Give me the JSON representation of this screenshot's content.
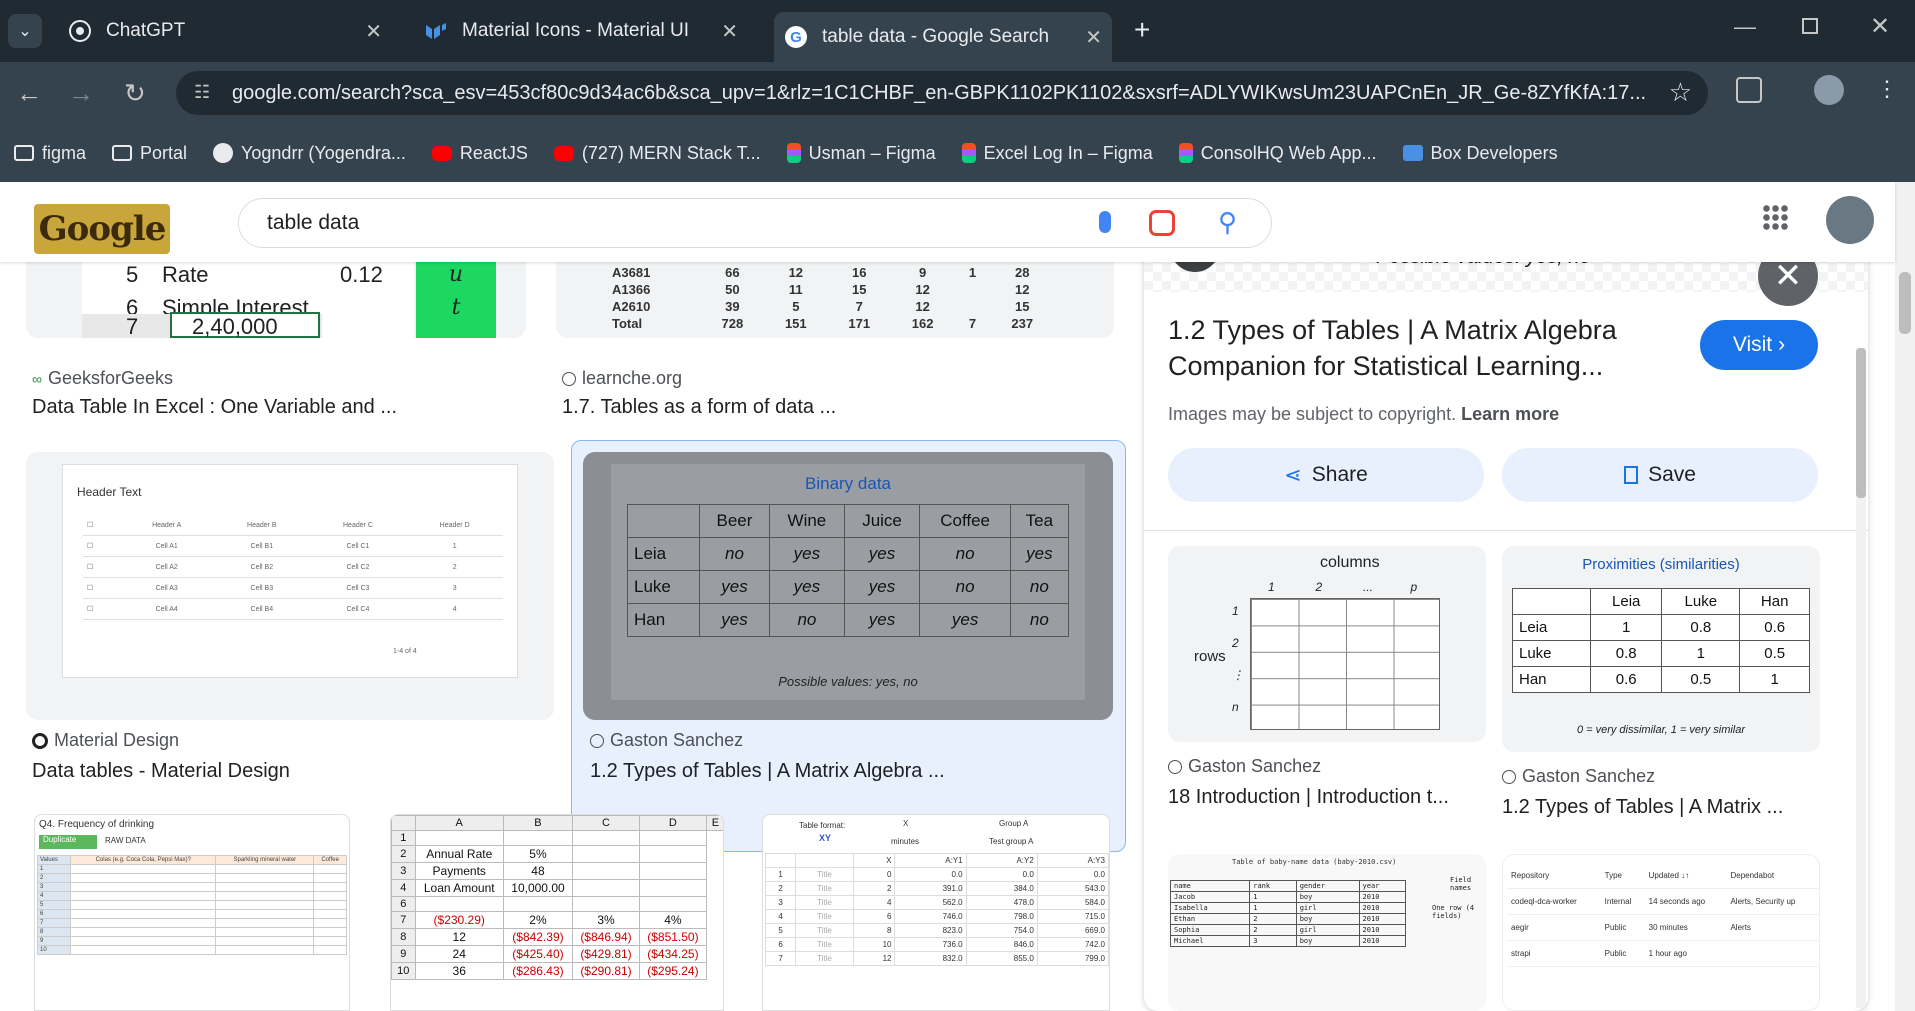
{
  "tabs": [
    {
      "title": "ChatGPT",
      "icon": "chatgpt-icon"
    },
    {
      "title": "Material Icons - Material UI",
      "icon": "mui-icon"
    },
    {
      "title": "table data - Google Search",
      "icon": "google-icon"
    }
  ],
  "omnibox": {
    "url": "google.com/search?sca_esv=453cf80c9d34ac6b&sca_upv=1&rlz=1C1CHBF_en-GBPK1102PK1102&sxsrf=ADLYWIKwsUm23UAPCnEn_JR_Ge-8ZYfKfA:17..."
  },
  "bookmarks": [
    {
      "label": "figma",
      "icon": "folder-icon"
    },
    {
      "label": "Portal",
      "icon": "folder-icon"
    },
    {
      "label": "Yogndrr (Yogendra...",
      "icon": "github-icon"
    },
    {
      "label": "ReactJS",
      "icon": "youtube-icon"
    },
    {
      "label": "(727) MERN Stack T...",
      "icon": "youtube-icon"
    },
    {
      "label": "Usman – Figma",
      "icon": "figma-icon"
    },
    {
      "label": "Excel Log In – Figma",
      "icon": "figma-icon"
    },
    {
      "label": "ConsolHQ Web App...",
      "icon": "figma-icon"
    },
    {
      "label": "Box Developers",
      "icon": "box-icon"
    }
  ],
  "search": {
    "query": "table data",
    "logo": "Google"
  },
  "results": {
    "r1": {
      "source": "GeeksforGeeks",
      "title": "Data Table In Excel : One Variable and ...",
      "rows": [
        [
          "5",
          "Rate",
          "0.12",
          "u"
        ],
        [
          "6",
          "Simple Interest",
          "",
          "t"
        ],
        [
          "7",
          "2,40,000",
          "",
          ""
        ]
      ]
    },
    "r2": {
      "source": "learnche.org",
      "title": "1.7. Tables as a form of data ...",
      "rows": [
        [
          "A3681",
          "66",
          "12",
          "16",
          "9",
          "1",
          "28"
        ],
        [
          "A1366",
          "50",
          "11",
          "15",
          "12",
          "",
          "12"
        ],
        [
          "A2610",
          "39",
          "5",
          "7",
          "12",
          "",
          "15"
        ],
        [
          "Total",
          "728",
          "151",
          "171",
          "162",
          "7",
          "237"
        ]
      ]
    },
    "r3": {
      "source": "Material Design",
      "title": "Data tables - Material Design",
      "header": "Header Text",
      "cols": [
        "Header A",
        "Header B",
        "Header C",
        "Header D"
      ],
      "rows": [
        [
          "Cell A1",
          "Cell B1",
          "Cell C1",
          "1"
        ],
        [
          "Cell A2",
          "Cell B2",
          "Cell C2",
          "2"
        ],
        [
          "Cell A3",
          "Cell B3",
          "Cell C3",
          "3"
        ],
        [
          "Cell A4",
          "Cell B4",
          "Cell C4",
          "4"
        ]
      ],
      "pager": "1-4 of 4"
    },
    "r4": {
      "source": "Gaston Sanchez",
      "title": "1.2 Types of Tables | A Matrix Algebra ...",
      "caption": "Binary data",
      "cols": [
        "",
        "Beer",
        "Wine",
        "Juice",
        "Coffee",
        "Tea"
      ],
      "rows": [
        [
          "Leia",
          "no",
          "yes",
          "yes",
          "no",
          "yes"
        ],
        [
          "Luke",
          "yes",
          "yes",
          "yes",
          "no",
          "no"
        ],
        [
          "Han",
          "yes",
          "no",
          "yes",
          "yes",
          "no"
        ]
      ],
      "footer": "Possible values:  yes,  no"
    },
    "r5": {
      "title": "Q4. Frequency of drinking",
      "btn": "Duplicate",
      "raw": "RAW DATA",
      "cols": [
        "Values",
        "Colas (e.g. Coca Cola, Pepsi Max)?",
        "Sparkling mineral water",
        "Coffee"
      ]
    },
    "r6": {
      "cols": [
        "A",
        "B",
        "C",
        "D",
        "E"
      ],
      "rows": [
        [
          "1",
          "",
          "",
          "",
          ""
        ],
        [
          "2",
          "Annual Rate",
          "5%",
          "",
          ""
        ],
        [
          "3",
          "Payments",
          "48",
          "",
          ""
        ],
        [
          "4",
          "Loan Amount",
          "10,000.00",
          "",
          ""
        ],
        [
          "6",
          "",
          "",
          "",
          ""
        ],
        [
          "7",
          "($230.29)",
          "2%",
          "3%",
          "4%"
        ],
        [
          "8",
          "12",
          "($842.39)",
          "($846.94)",
          "($851.50)"
        ],
        [
          "9",
          "24",
          "($425.40)",
          "($429.81)",
          "($434.25)"
        ],
        [
          "10",
          "36",
          "($286.43)",
          "($290.81)",
          "($295.24)"
        ]
      ]
    },
    "r7": {
      "format_label": "Table format:",
      "format_value": "XY",
      "groupA": "Group A",
      "x": "X",
      "minutes": "minutes",
      "test": "Test group A",
      "cols": [
        "X",
        "A:Y1",
        "A:Y2",
        "A:Y3"
      ],
      "rows": [
        [
          "1",
          "Title",
          "0",
          "0.0",
          "0.0",
          "0.0"
        ],
        [
          "2",
          "Title",
          "2",
          "391.0",
          "384.0",
          "543.0"
        ],
        [
          "3",
          "Title",
          "4",
          "562.0",
          "478.0",
          "584.0"
        ],
        [
          "4",
          "Title",
          "6",
          "746.0",
          "798.0",
          "715.0"
        ],
        [
          "5",
          "Title",
          "8",
          "823.0",
          "754.0",
          "669.0"
        ],
        [
          "6",
          "Title",
          "10",
          "736.0",
          "846.0",
          "742.0"
        ],
        [
          "7",
          "Title",
          "12",
          "832.0",
          "855.0",
          "799.0"
        ]
      ]
    }
  },
  "panel": {
    "top_text": "Possible values:  yes,  no",
    "title": "1.2 Types of Tables | A Matrix Algebra Companion for Statistical Learning...",
    "visit": "Visit",
    "copyright": "Images may be subject to copyright.",
    "learn_more": "Learn more",
    "share": "Share",
    "save": "Save",
    "rel1": {
      "source": "Gaston Sanchez",
      "title": "18 Introduction | Introduction t...",
      "columns": "columns",
      "rows": "rows",
      "colnums": [
        "1",
        "2",
        "...",
        "p"
      ],
      "rownums": [
        "1",
        "2",
        "⋮",
        "n"
      ]
    },
    "rel2": {
      "source": "Gaston Sanchez",
      "title": "1.2 Types of Tables | A Matrix ...",
      "caption": "Proximities (similarities)",
      "cols": [
        "",
        "Leia",
        "Luke",
        "Han"
      ],
      "rows": [
        [
          "Leia",
          "1",
          "0.8",
          "0.6"
        ],
        [
          "Luke",
          "0.8",
          "1",
          "0.5"
        ],
        [
          "Han",
          "0.6",
          "0.5",
          "1"
        ]
      ],
      "footer": "0 = very dissimilar,  1 = very similar"
    },
    "rel3": {
      "caption": "Table of baby-name data (baby-2010.csv)",
      "cols": [
        "name",
        "rank",
        "gender",
        "year"
      ],
      "rows": [
        [
          "Jacob",
          "1",
          "boy",
          "2010"
        ],
        [
          "Isabella",
          "1",
          "girl",
          "2010"
        ],
        [
          "Ethan",
          "2",
          "boy",
          "2010"
        ],
        [
          "Sophia",
          "2",
          "girl",
          "2010"
        ],
        [
          "Michael",
          "3",
          "boy",
          "2010"
        ]
      ],
      "field": "Field names",
      "onerow": "One row (4 fields)"
    },
    "rel4": {
      "cols": [
        "Repository",
        "Type",
        "Updated ↓↑",
        "Dependabot"
      ],
      "rows": [
        [
          "codeql-dca-worker",
          "Internal",
          "14 seconds ago",
          "Alerts, Security up"
        ],
        [
          "aegir",
          "Public",
          "30 minutes",
          "Alerts"
        ],
        [
          "strapi",
          "Public",
          "1 hour ago",
          ""
        ]
      ]
    }
  }
}
